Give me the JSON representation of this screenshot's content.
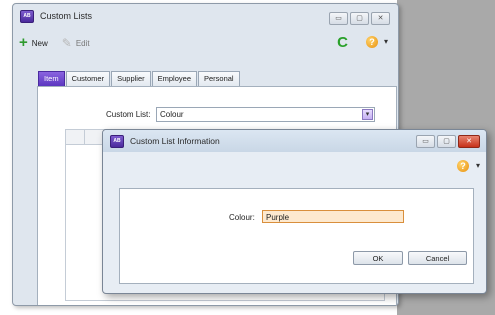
{
  "main_window": {
    "title": "Custom Lists",
    "app_icon_text": "AB",
    "window_controls": {
      "minimize": "▭",
      "maximize": "▢",
      "close": "✕"
    },
    "toolbar": {
      "new_label": "New",
      "edit_label": "Edit",
      "refresh_symbol": "C",
      "help_symbol": "?",
      "help_caret": "▾"
    },
    "tabs": [
      {
        "label": "Item",
        "active": true
      },
      {
        "label": "Customer",
        "active": false
      },
      {
        "label": "Supplier",
        "active": false
      },
      {
        "label": "Employee",
        "active": false
      },
      {
        "label": "Personal",
        "active": false
      }
    ],
    "custom_list": {
      "label": "Custom List:",
      "value": "Colour",
      "dropdown_symbol": "▾"
    }
  },
  "dialog": {
    "title": "Custom List Information",
    "app_icon_text": "AB",
    "window_controls": {
      "minimize": "▭",
      "maximize": "▢",
      "close": "✕"
    },
    "help_symbol": "?",
    "help_caret": "▾",
    "colour_label": "Colour:",
    "colour_value": "Purple",
    "ok_label": "OK",
    "cancel_label": "Cancel"
  },
  "colors": {
    "accent": "#5b36bf",
    "input_highlight": "#fde9cf",
    "backdrop": "#a9a9a9"
  }
}
